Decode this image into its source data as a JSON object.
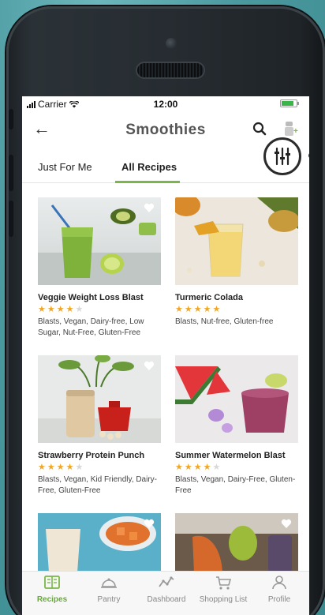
{
  "status_bar": {
    "carrier": "Carrier",
    "time": "12:00"
  },
  "navbar": {
    "title": "Smoothies",
    "back_icon": "arrow-left-icon",
    "search_icon": "search-icon"
  },
  "tabs": [
    {
      "label": "Just For Me",
      "active": false
    },
    {
      "label": "All Recipes",
      "active": true
    }
  ],
  "recipes": [
    {
      "name": "Veggie Weight Loss Blast",
      "rating": 4,
      "tags": "Blasts, Vegan, Dairy-free, Low Sugar, Nut-Free, Gluten-Free"
    },
    {
      "name": "Turmeric Colada",
      "rating": 5,
      "tags": "Blasts, Nut-free, Gluten-free"
    },
    {
      "name": "Strawberry Protein Punch",
      "rating": 4,
      "tags": "Blasts, Vegan, Kid Friendly, Dairy-Free, Gluten-Free"
    },
    {
      "name": "Summer Watermelon Blast",
      "rating": 4,
      "tags": "Blasts, Vegan, Dairy-Free, Gluten-Free"
    }
  ],
  "tab_bar": [
    {
      "label": "Recipes",
      "active": true
    },
    {
      "label": "Pantry",
      "active": false
    },
    {
      "label": "Dashboard",
      "active": false
    },
    {
      "label": "Shopping List",
      "active": false
    },
    {
      "label": "Profile",
      "active": false
    }
  ],
  "colors": {
    "accent_green": "#7ab648",
    "star": "#f2a623",
    "backdrop": "#4f9ea5"
  }
}
